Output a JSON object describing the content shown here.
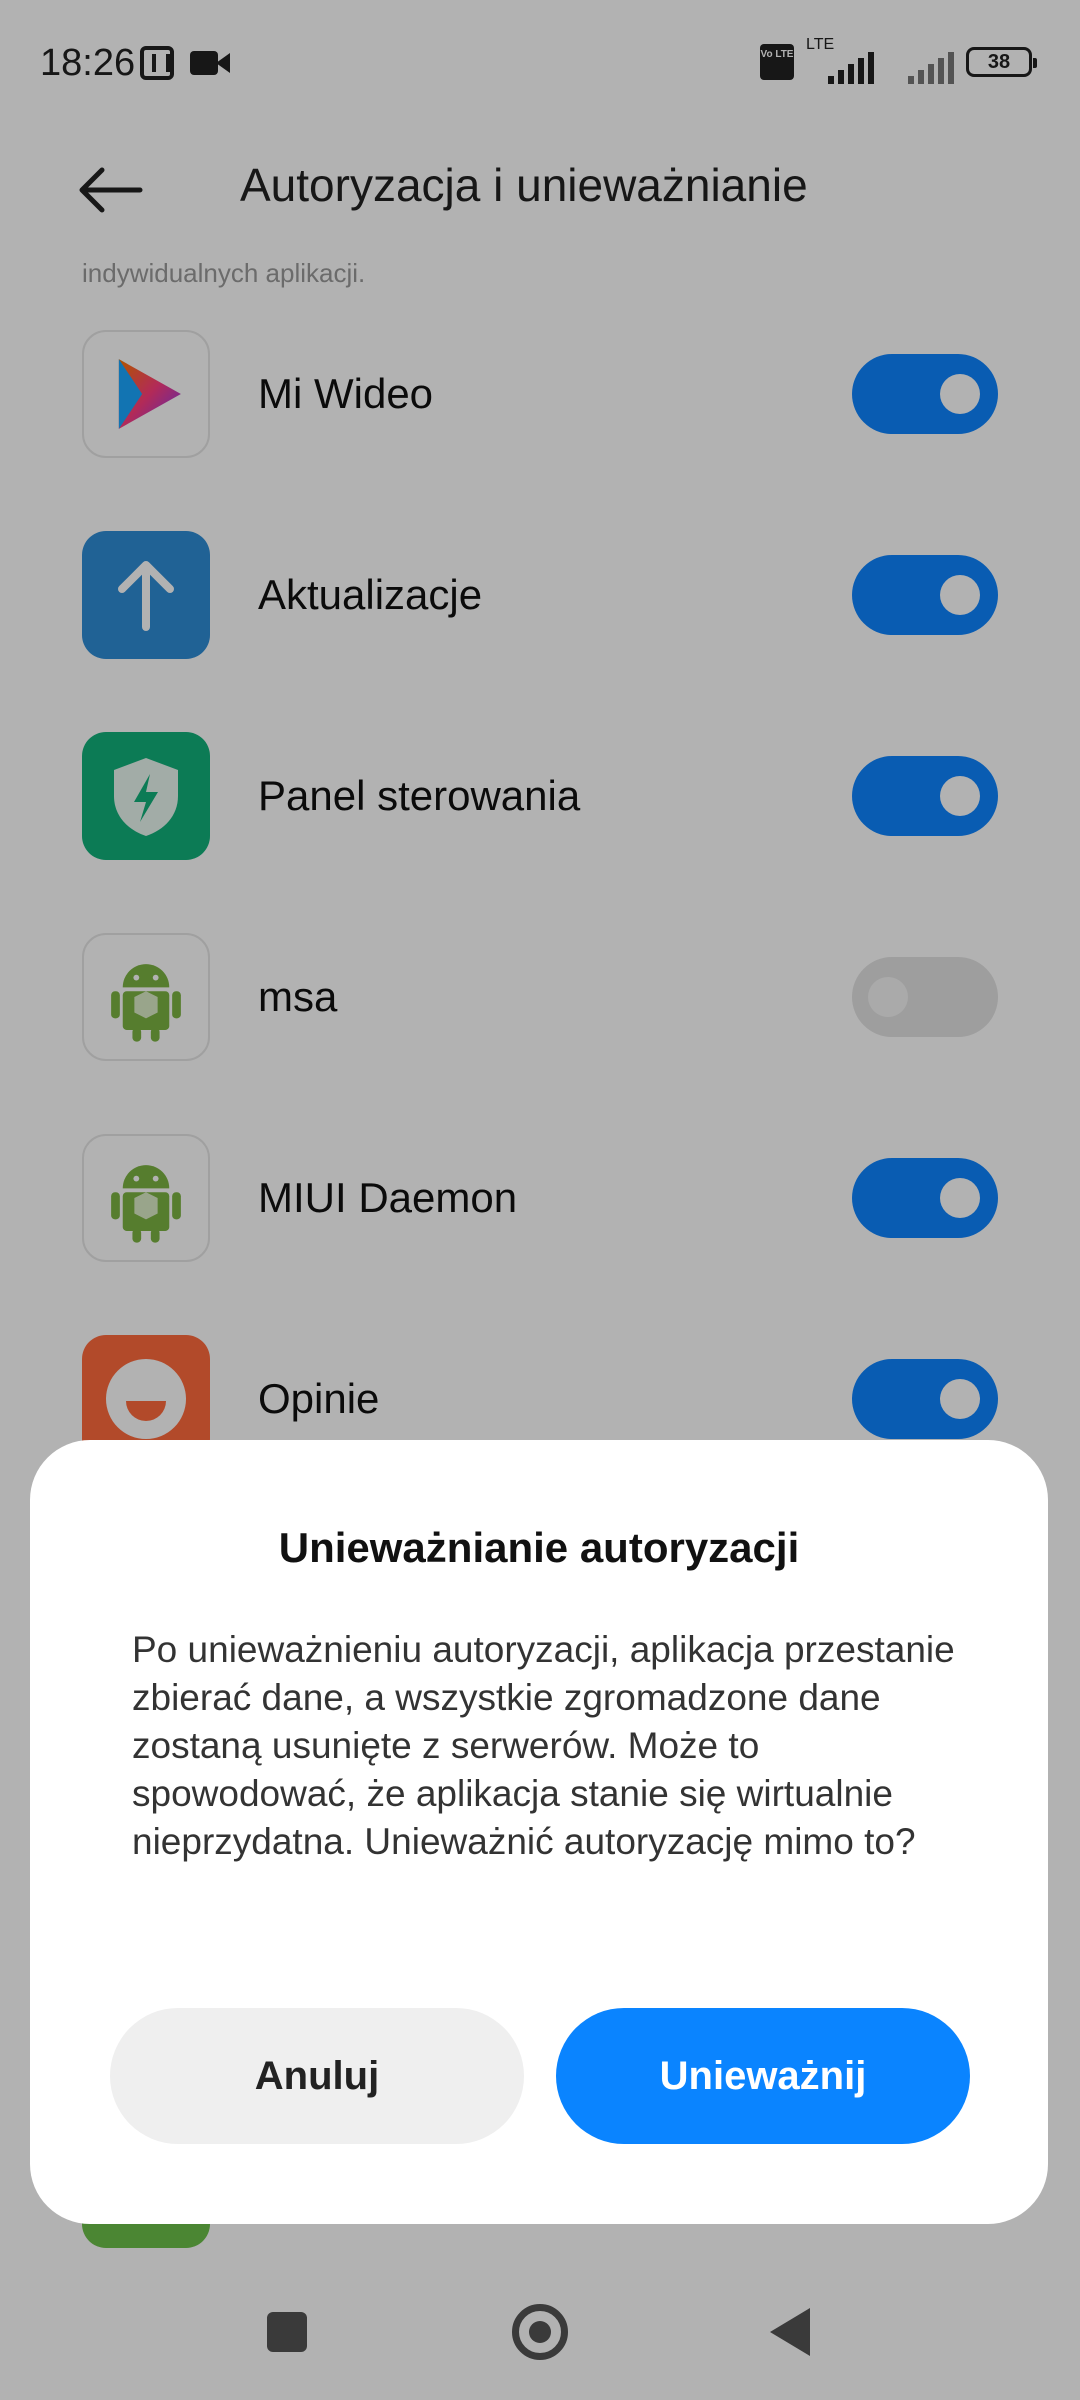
{
  "status_bar": {
    "time": "18:26",
    "volte": "Vo LTE",
    "network_label": "LTE",
    "battery": "38"
  },
  "header": {
    "title": "Autoryzacja i unieważnianie"
  },
  "subtitle": "indywidualnych aplikacji.",
  "apps": [
    {
      "label": "Mi Wideo",
      "icon": "mi-video-icon",
      "enabled": true
    },
    {
      "label": "Aktualizacje",
      "icon": "updater-arrow-icon",
      "enabled": true
    },
    {
      "label": "Panel sterowania",
      "icon": "shield-bolt-icon",
      "enabled": true
    },
    {
      "label": "msa",
      "icon": "android-robot-icon",
      "enabled": false
    },
    {
      "label": "MIUI Daemon",
      "icon": "android-robot-icon",
      "enabled": true
    },
    {
      "label": "Opinie",
      "icon": "feedback-face-icon",
      "enabled": true
    }
  ],
  "dialog": {
    "title": "Unieważnianie autoryzacji",
    "message": "Po unieważnieniu autoryzacji, aplikacja przestanie zbierać dane, a wszystkie zgromadzone dane zostaną usunięte z serwerów. Może to spowodować, że aplikacja stanie się wirtualnie nieprzydatna. Unieważnić autoryzację mimo to?",
    "cancel_label": "Anuluj",
    "confirm_label": "Unieważnij"
  },
  "colors": {
    "accent": "#0a84ff",
    "toggle_on": "#0d84ff",
    "toggle_off": "#e2e2e2"
  }
}
